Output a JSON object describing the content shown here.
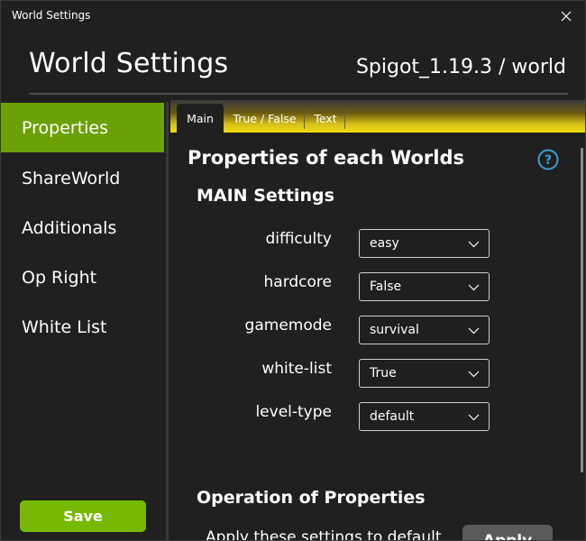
{
  "window": {
    "title": "World Settings"
  },
  "header": {
    "title": "World Settings",
    "server_world": "Spigot_1.19.3 / world"
  },
  "sidebar": {
    "items": [
      {
        "label": "Properties",
        "active": true
      },
      {
        "label": "ShareWorld",
        "active": false
      },
      {
        "label": "Additionals",
        "active": false
      },
      {
        "label": "Op Right",
        "active": false
      },
      {
        "label": "White List",
        "active": false
      }
    ],
    "save_label": "Save"
  },
  "tabs": [
    {
      "label": "Main",
      "active": true
    },
    {
      "label": "True / False",
      "active": false
    },
    {
      "label": "Text",
      "active": false
    }
  ],
  "main": {
    "section_title": "Properties of each Worlds",
    "help_icon": "question-circle-icon",
    "subsection_title": "MAIN Settings",
    "properties": [
      {
        "label": "difficulty",
        "value": "easy"
      },
      {
        "label": "hardcore",
        "value": "False"
      },
      {
        "label": "gamemode",
        "value": "survival"
      },
      {
        "label": "white-list",
        "value": "True"
      },
      {
        "label": "level-type",
        "value": "default"
      }
    ],
    "operation_title": "Operation of Properties",
    "apply_text": "Apply these settings to default",
    "apply_label": "Apply"
  },
  "colors": {
    "accent_green": "#76b900",
    "active_green": "#6ca007",
    "tab_yellow": "#f2dd10",
    "help_blue": "#3aa0d0",
    "background": "#202020"
  }
}
